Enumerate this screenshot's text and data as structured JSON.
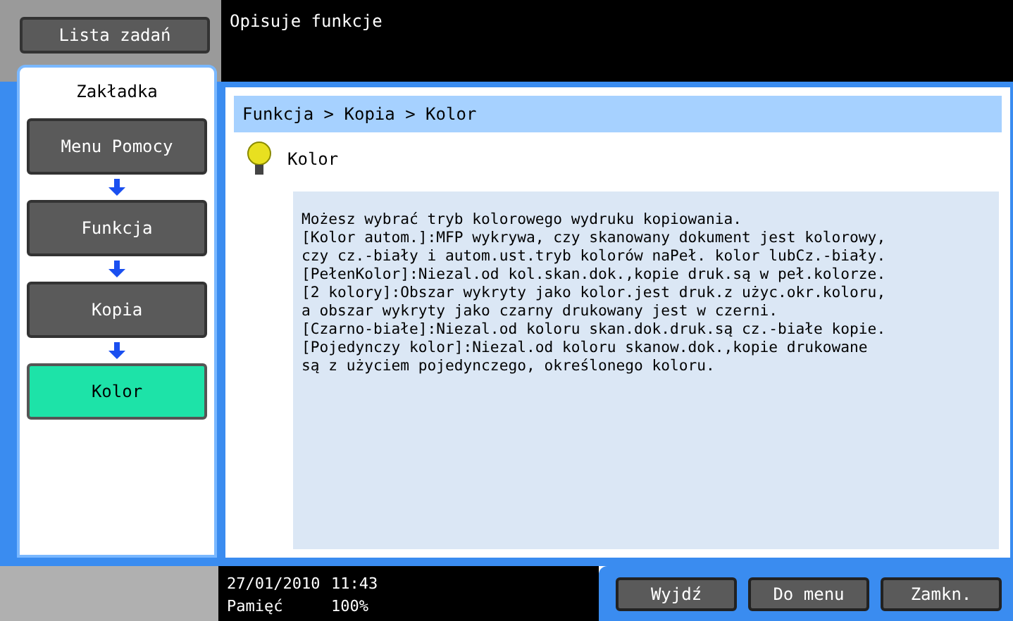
{
  "header": {
    "job_list_button": "Lista zadań",
    "title": "Opisuje funkcje"
  },
  "sidebar": {
    "tab": "Zakładka",
    "items": [
      {
        "label": "Menu Pomocy",
        "selected": false
      },
      {
        "label": "Funkcja",
        "selected": false
      },
      {
        "label": "Kopia",
        "selected": false
      },
      {
        "label": "Kolor",
        "selected": true
      }
    ]
  },
  "breadcrumb": "Funkcja > Kopia > Kolor",
  "topic": {
    "title": "Kolor",
    "description": "Możesz wybrać tryb kolorowego wydruku kopiowania.\n[Kolor autom.]:MFP wykrywa, czy skanowany dokument jest kolorowy,\nczy cz.-biały i autom.ust.tryb kolorów naPeł. kolor lubCz.-biały.\n[PełenKolor]:Niezal.od kol.skan.dok.,kopie druk.są w peł.kolorze.\n[2 kolory]:Obszar wykryty jako kolor.jest druk.z użyc.okr.koloru,\na obszar wykryty jako czarny drukowany jest w czerni.\n[Czarno-białe]:Niezal.od koloru skan.dok.druk.są cz.-białe kopie.\n[Pojedynczy kolor]:Niezal.od koloru skanow.dok.,kopie drukowane\nsą z użyciem pojedynczego, określonego koloru."
  },
  "status": {
    "date": "27/01/2010",
    "time": "11:43",
    "memory_label": "Pamięć",
    "memory_value": "100%"
  },
  "buttons": [
    "Wyjdź",
    "Do menu",
    "Zamkn."
  ]
}
